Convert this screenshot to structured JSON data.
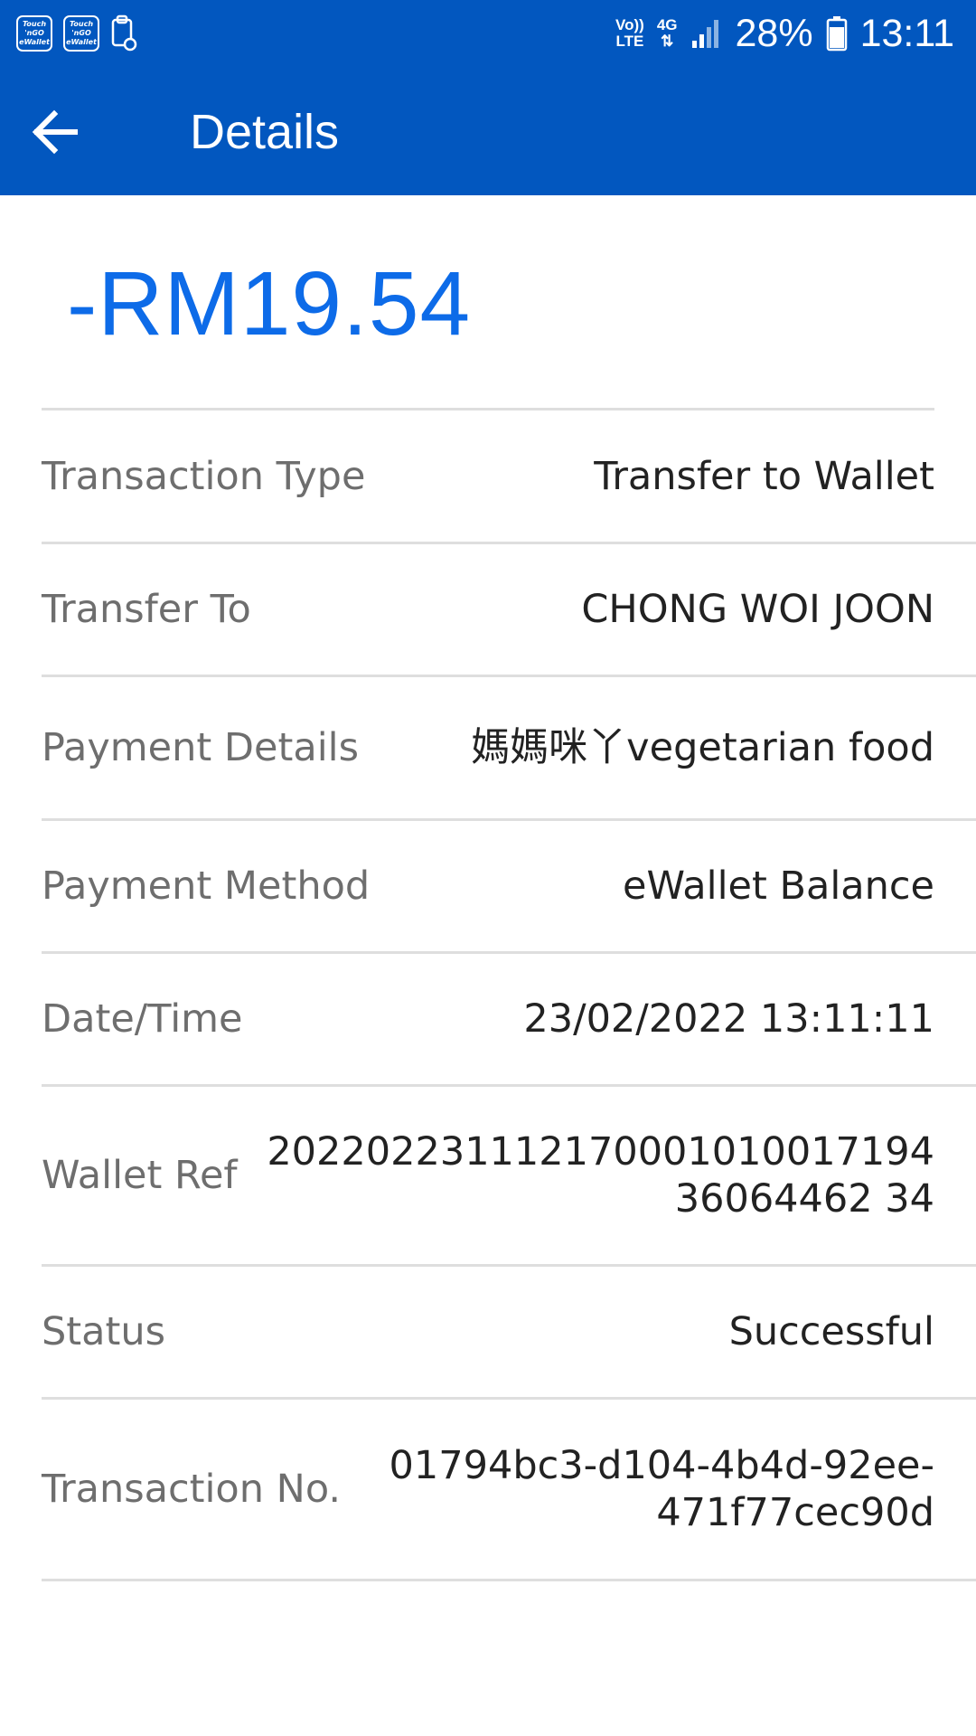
{
  "status_bar": {
    "tng_icon_text": "Touch 'n GO eWallet",
    "volte_line1": "Vo))",
    "volte_line2": "LTE",
    "network": "4G",
    "battery": "28%",
    "time": "13:11",
    "icons": [
      "tng-ewallet-icon",
      "tng-ewallet-icon",
      "clipboard-icon",
      "volte-icon",
      "4g-icon",
      "signal-icon",
      "battery-icon"
    ]
  },
  "header": {
    "title": "Details",
    "back_icon": "arrow-left-icon"
  },
  "amount": "-RM19.54",
  "details": [
    {
      "label": "Transaction Type",
      "value": "Transfer to Wallet"
    },
    {
      "label": "Transfer To",
      "value": "CHONG WOI JOON"
    },
    {
      "label": "Payment Details",
      "value": "媽媽咪丫vegetarian food"
    },
    {
      "label": "Payment Method",
      "value": "eWallet Balance"
    },
    {
      "label": "Date/Time",
      "value": "23/02/2022 13:11:11"
    },
    {
      "label": "Wallet Ref",
      "value": "20220223111217000101001719436064462 34"
    },
    {
      "label": "Status",
      "value": "Successful"
    },
    {
      "label": "Transaction No.",
      "value": "01794bc3-d104-4b4d-92ee-471f77cec90d"
    }
  ],
  "colors": {
    "brand_blue": "#0257bf",
    "amount_blue": "#0d6be8",
    "label_gray": "#6e6e6e",
    "value_dark": "#222222"
  }
}
